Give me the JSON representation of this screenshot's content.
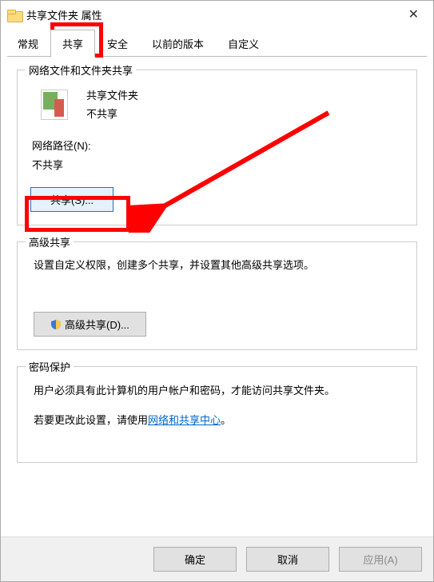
{
  "window": {
    "title": "共享文件夹 属性"
  },
  "tabs": {
    "general": "常规",
    "share": "共享",
    "security": "安全",
    "previous": "以前的版本",
    "custom": "自定义"
  },
  "group_network": {
    "title": "网络文件和文件夹共享",
    "folder_name": "共享文件夹",
    "status": "不共享",
    "path_label": "网络路径(N):",
    "path_value": "不共享",
    "share_button": "共享(S)..."
  },
  "group_advanced": {
    "title": "高级共享",
    "desc": "设置自定义权限，创建多个共享，并设置其他高级共享选项。",
    "button": "高级共享(D)..."
  },
  "group_password": {
    "title": "密码保护",
    "desc1": "用户必须具有此计算机的用户帐户和密码，才能访问共享文件夹。",
    "desc2_prefix": "若要更改此设置，请使用",
    "desc2_link": "网络和共享中心",
    "desc2_suffix": "。"
  },
  "footer": {
    "ok": "确定",
    "cancel": "取消",
    "apply": "应用(A)"
  }
}
